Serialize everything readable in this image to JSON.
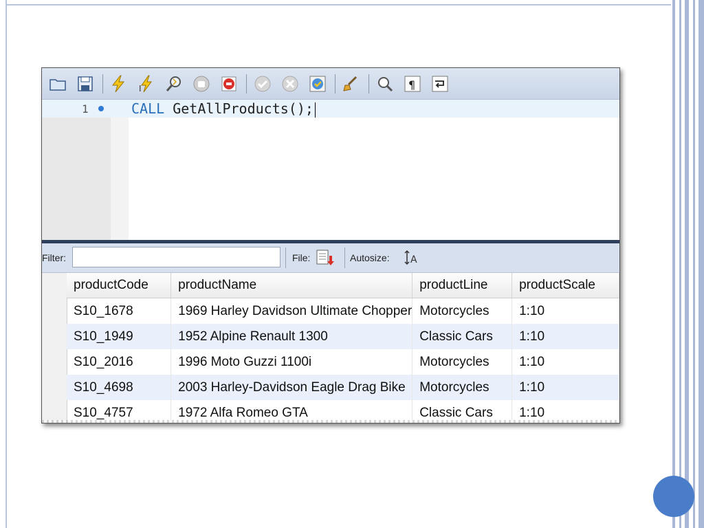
{
  "toolbar": {
    "icons": [
      "folder-open-icon",
      "save-icon",
      "execute-icon",
      "execute-current-icon",
      "explain-icon",
      "stop-icon",
      "stop-on-error-icon",
      "commit-icon",
      "rollback-icon",
      "autocommit-icon",
      "beautify-icon",
      "find-icon",
      "invisible-chars-icon",
      "word-wrap-icon"
    ]
  },
  "editor": {
    "line_number": "1",
    "keyword": "CALL",
    "statement": " GetAllProducts();"
  },
  "filterbar": {
    "filter_label": "Filter:",
    "filter_value": "",
    "file_label": "File:",
    "autosize_label": "Autosize:"
  },
  "grid": {
    "columns": [
      "productCode",
      "productName",
      "productLine",
      "productScale"
    ],
    "rows": [
      [
        "S10_1678",
        "1969 Harley Davidson Ultimate Chopper",
        "Motorcycles",
        "1:10"
      ],
      [
        "S10_1949",
        "1952 Alpine Renault 1300",
        "Classic Cars",
        "1:10"
      ],
      [
        "S10_2016",
        "1996 Moto Guzzi 1100i",
        "Motorcycles",
        "1:10"
      ],
      [
        "S10_4698",
        "2003 Harley-Davidson Eagle Drag Bike",
        "Motorcycles",
        "1:10"
      ],
      [
        "S10_4757",
        "1972 Alfa Romeo GTA",
        "Classic Cars",
        "1:10"
      ]
    ]
  },
  "colors": {
    "keyword": "#2a6fb7",
    "alt_row": "#e9f0fb",
    "page_dot": "#4a7dc9"
  }
}
